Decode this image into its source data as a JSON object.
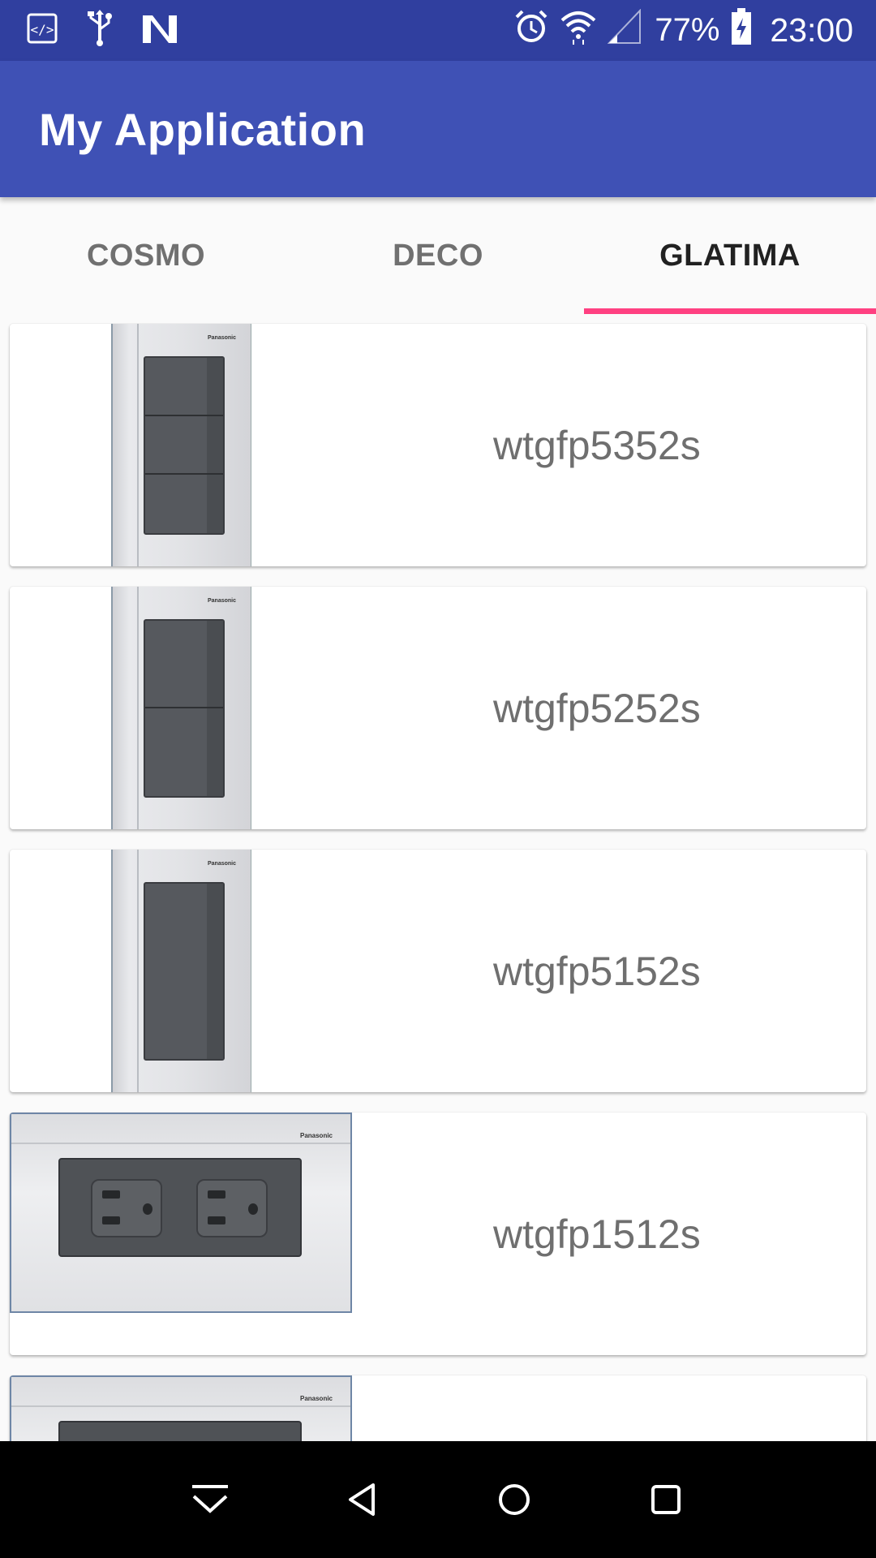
{
  "status_bar": {
    "left_icons": [
      "code-icon",
      "usb-icon",
      "notification-n-icon"
    ],
    "right_icons": [
      "alarm-icon",
      "wifi-icon",
      "signal-icon",
      "battery-charging-icon"
    ],
    "battery": "77%",
    "time": "23:00"
  },
  "app_bar": {
    "title": "My Application"
  },
  "tabs": [
    {
      "label": "COSMO",
      "active": false
    },
    {
      "label": "DECO",
      "active": false
    },
    {
      "label": "GLATIMA",
      "active": true
    }
  ],
  "colors": {
    "status_bar": "#303f9f",
    "app_bar": "#3f51b5",
    "tab_indicator": "#ff4081"
  },
  "items": [
    {
      "name": "wtgfp5352s",
      "image": "three-gang-switch-plate"
    },
    {
      "name": "wtgfp5252s",
      "image": "two-gang-switch-plate"
    },
    {
      "name": "wtgfp5152s",
      "image": "one-gang-switch-plate"
    },
    {
      "name": "wtgfp1512s",
      "image": "duplex-outlet-plate"
    },
    {
      "name": "",
      "image": "outlet-plate-partial"
    }
  ],
  "nav_bar": {
    "buttons": [
      "collapse-icon",
      "back-icon",
      "home-icon",
      "recents-icon"
    ]
  }
}
